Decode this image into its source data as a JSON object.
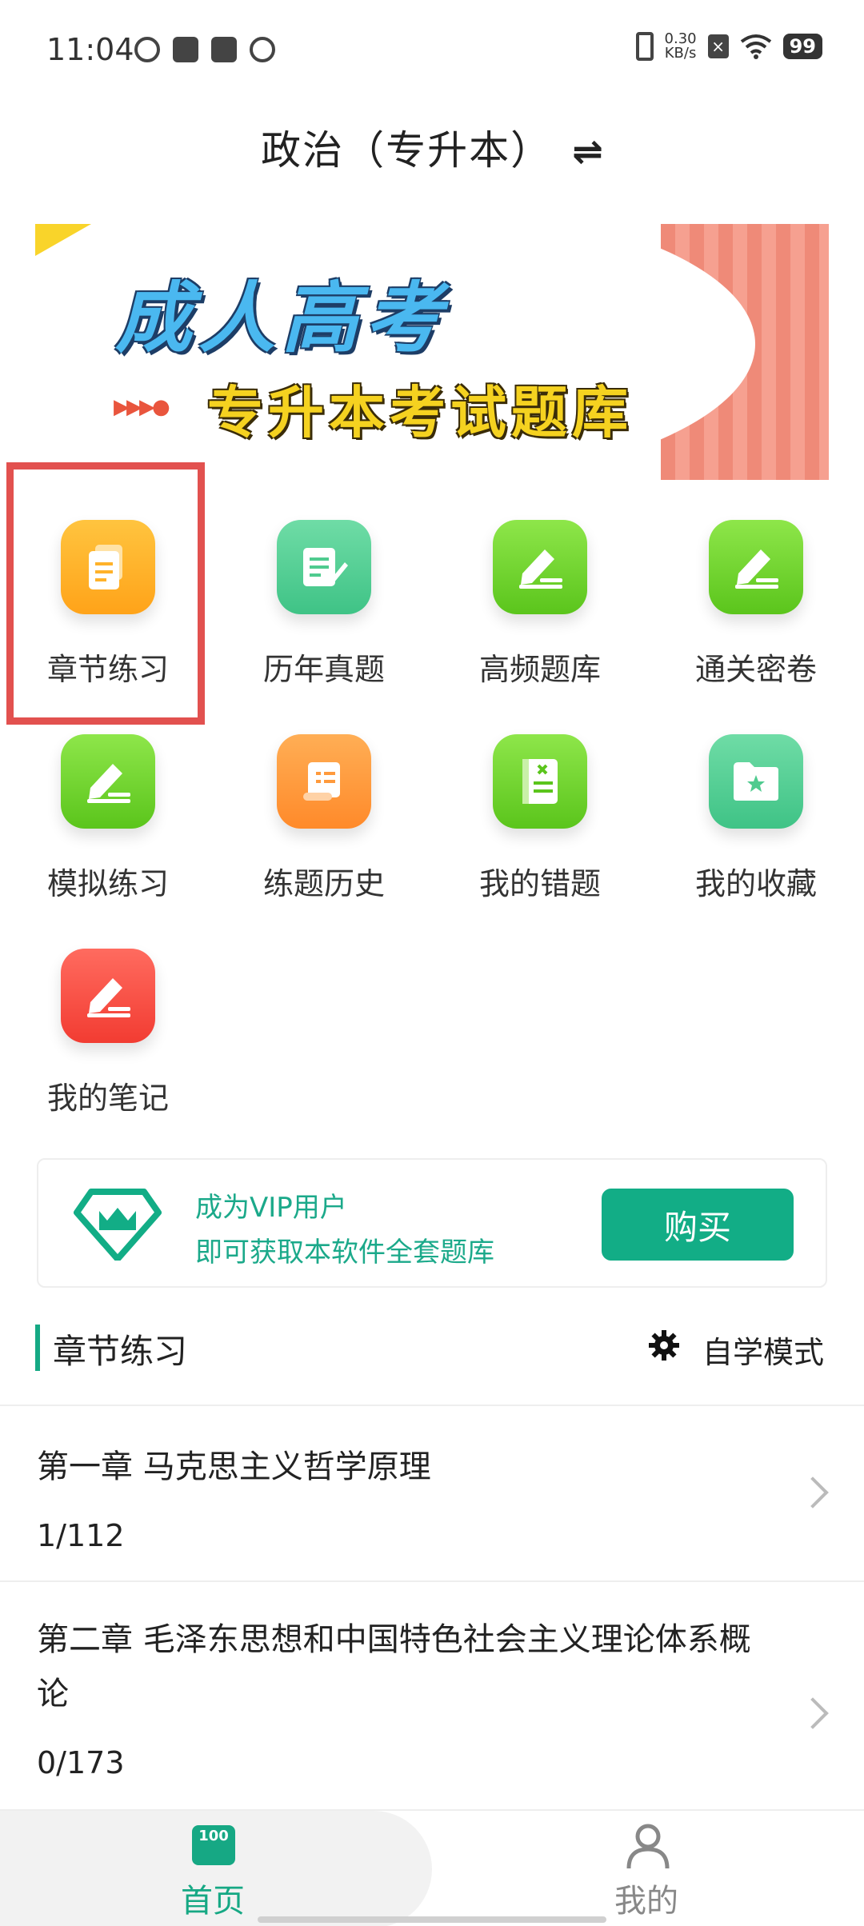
{
  "status_bar": {
    "time": "11:04",
    "net_speed_top": "0.30",
    "net_speed_bottom": "KB/s",
    "battery": "99"
  },
  "header": {
    "title": "政治（专升本）",
    "switch_icon": "⇌"
  },
  "banner": {
    "title": "成人高考",
    "subtitle": "专升本考试题库",
    "arrows": "▶▶▶●"
  },
  "grid": [
    {
      "label": "章节练习",
      "icon": "document-icon",
      "color": "#ffb22a"
    },
    {
      "label": "历年真题",
      "icon": "edit-note-icon",
      "color": "#4fcb8f"
    },
    {
      "label": "高频题库",
      "icon": "pencil-line-icon",
      "color": "#6fd332"
    },
    {
      "label": "通关密卷",
      "icon": "pencil-line-icon",
      "color": "#6fd332"
    },
    {
      "label": "模拟练习",
      "icon": "pencil-line-icon",
      "color": "#6fd332"
    },
    {
      "label": "练题历史",
      "icon": "scroll-icon",
      "color": "#ff9a3c"
    },
    {
      "label": "我的错题",
      "icon": "wrong-book-icon",
      "color": "#6fd332"
    },
    {
      "label": "我的收藏",
      "icon": "star-folder-icon",
      "color": "#4fcb8f"
    },
    {
      "label": "我的笔记",
      "icon": "pencil-line-icon",
      "color": "#f44b40"
    }
  ],
  "vip": {
    "line1": "成为VIP用户",
    "line2": "即可获取本软件全套题库",
    "buy_label": "购买",
    "accent": "#12ad86"
  },
  "section": {
    "title": "章节练习",
    "mode_label": "自学模式"
  },
  "chapters": [
    {
      "title": "第一章 马克思主义哲学原理",
      "progress": "1/112"
    },
    {
      "title": "第二章 毛泽东思想和中国特色社会主义理论体系概论",
      "progress": "0/173"
    }
  ],
  "bottom_nav": {
    "home_label": "首页",
    "home_icon_text": "100",
    "mine_label": "我的"
  }
}
